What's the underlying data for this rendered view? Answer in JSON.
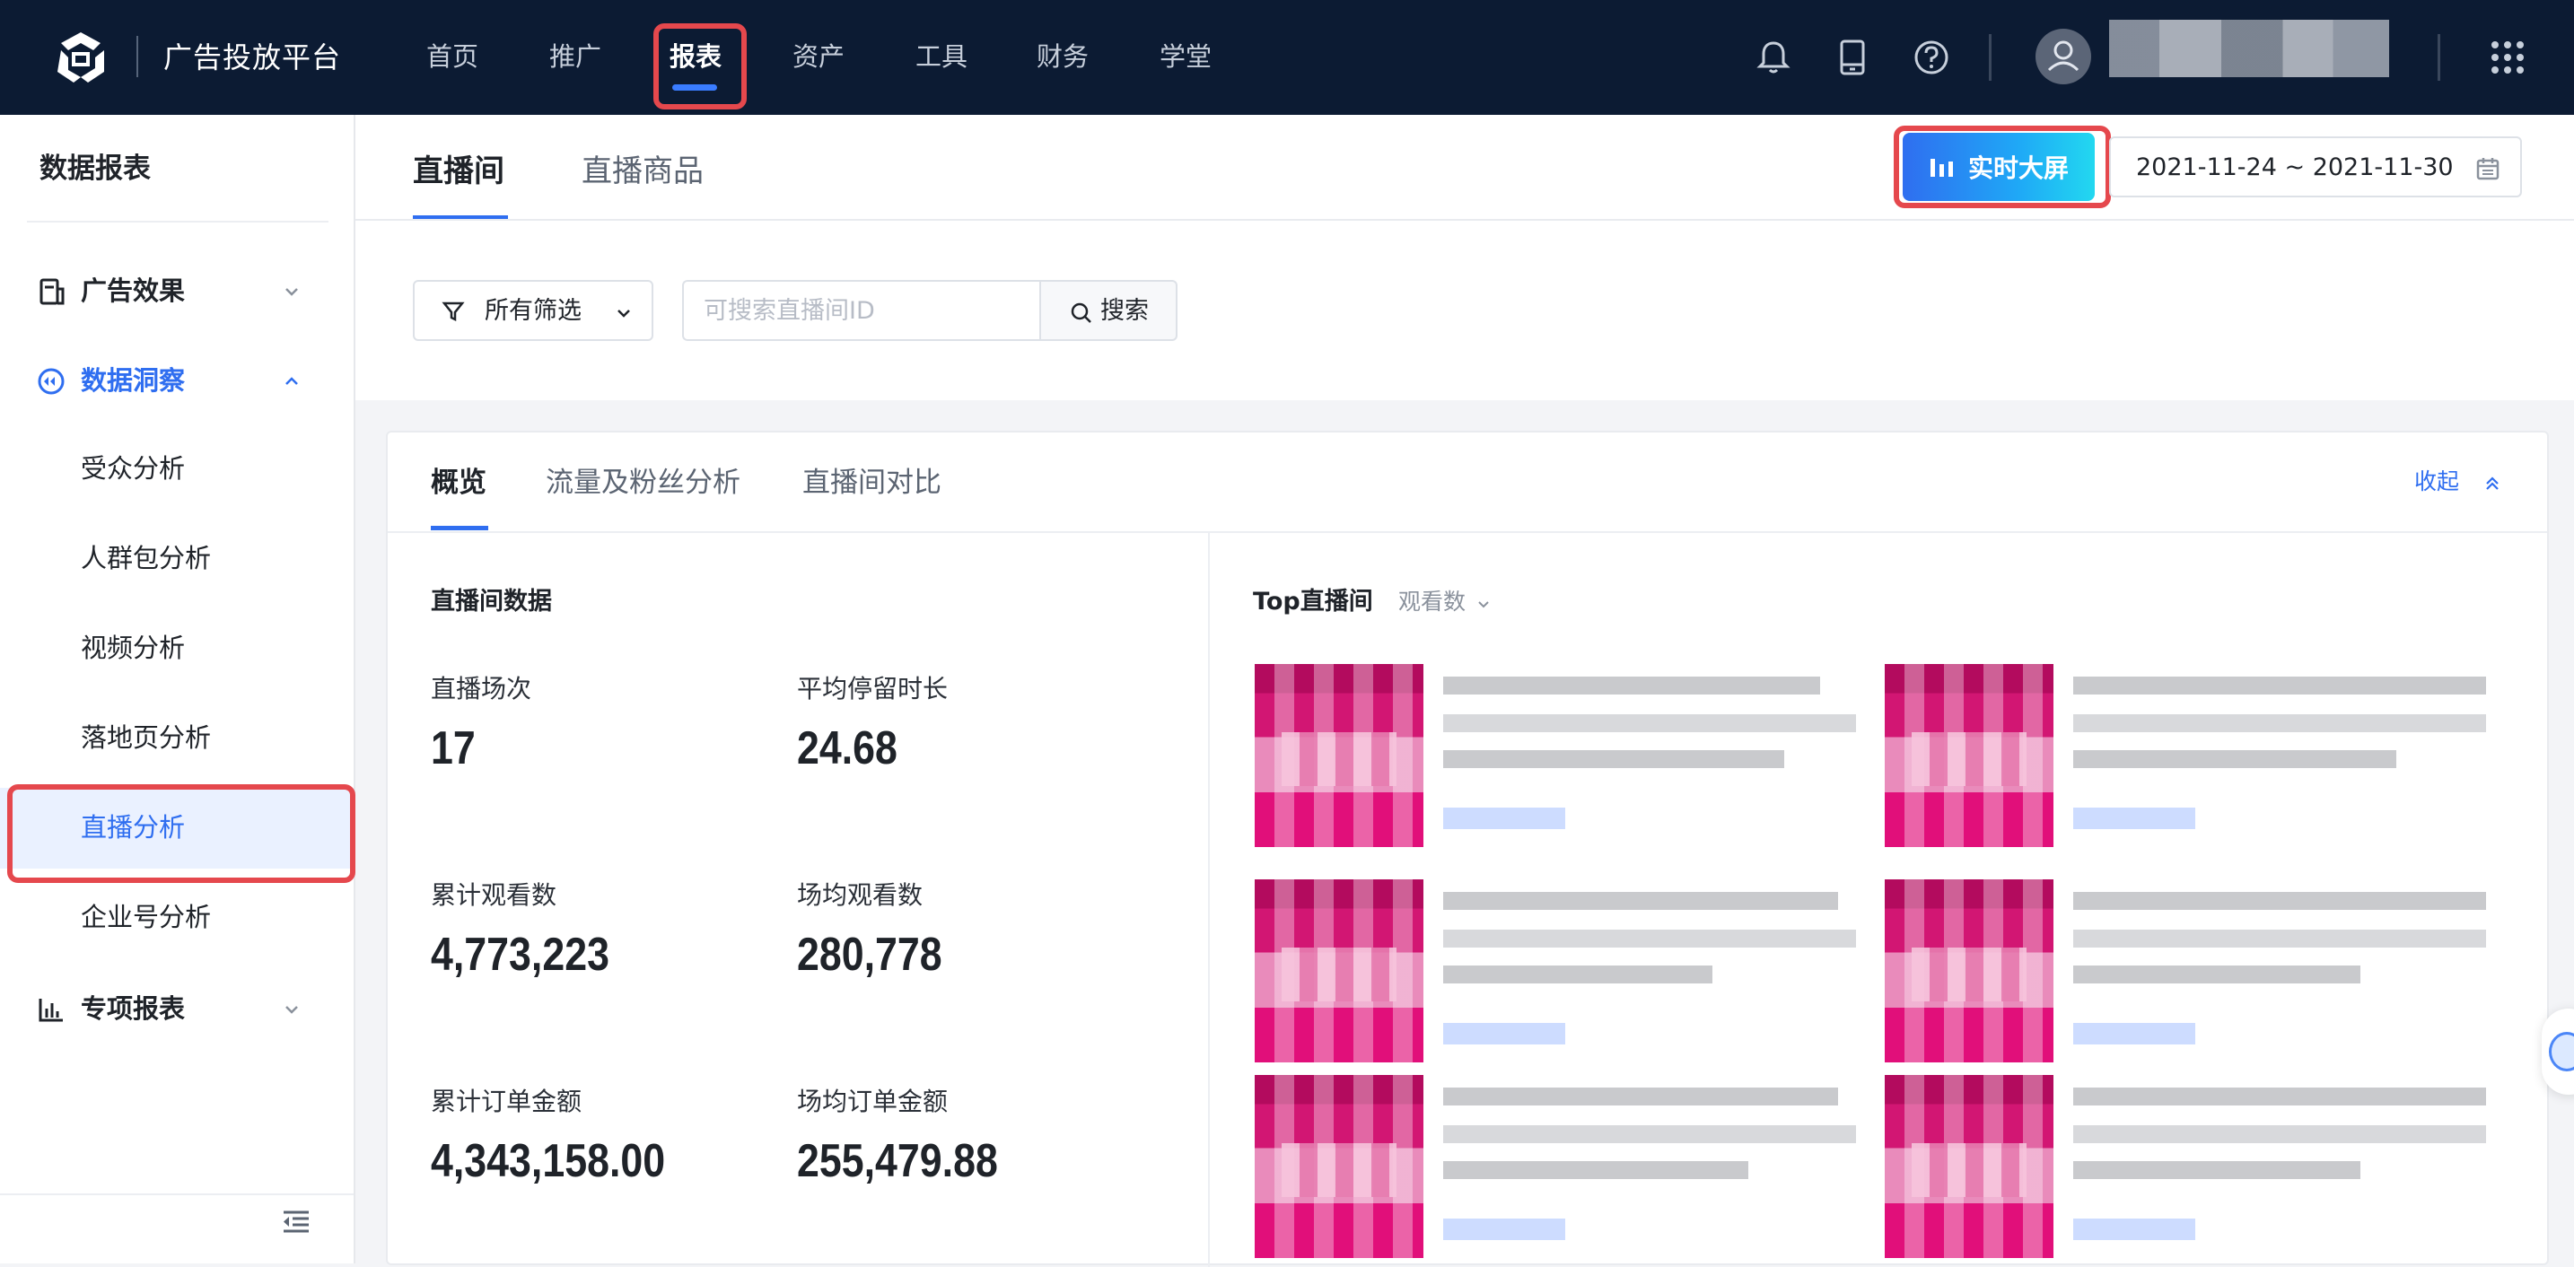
{
  "app": {
    "brand": "广告投放平台",
    "nav": [
      "首页",
      "推广",
      "报表",
      "资产",
      "工具",
      "财务",
      "学堂"
    ],
    "nav_active": "报表"
  },
  "sidebar": {
    "title": "数据报表",
    "group_ad_effect": "广告效果",
    "group_data_insight": "数据洞察",
    "items": [
      "受众分析",
      "人群包分析",
      "视频分析",
      "落地页分析",
      "直播分析",
      "企业号分析"
    ],
    "active_item": "直播分析",
    "group_special_report": "专项报表"
  },
  "main": {
    "tabs": [
      "直播间",
      "直播商品"
    ],
    "realtime_button": "实时大屏",
    "date_range": "2021-11-24 ~ 2021-11-30",
    "filter_label": "所有筛选",
    "search_placeholder": "可搜索直播间ID",
    "search_button": "搜索"
  },
  "card": {
    "tabs": [
      "概览",
      "流量及粉丝分析",
      "直播间对比"
    ],
    "collapse": "收起",
    "stats_title": "直播间数据",
    "metrics": [
      {
        "label": "直播场次",
        "value": "17"
      },
      {
        "label": "平均停留时长",
        "value": "24.68"
      },
      {
        "label": "累计观看数",
        "value": "4,773,223"
      },
      {
        "label": "场均观看数",
        "value": "280,778"
      },
      {
        "label": "累计订单金额",
        "value": "4,343,158.00"
      },
      {
        "label": "场均订单金额",
        "value": "255,479.88"
      }
    ],
    "top_title": "Top直播间",
    "top_sort": "观看数"
  },
  "colors": {
    "topbar": "#0c1b33",
    "accent": "#2f6ef0",
    "highlight_box": "#e5484d"
  }
}
